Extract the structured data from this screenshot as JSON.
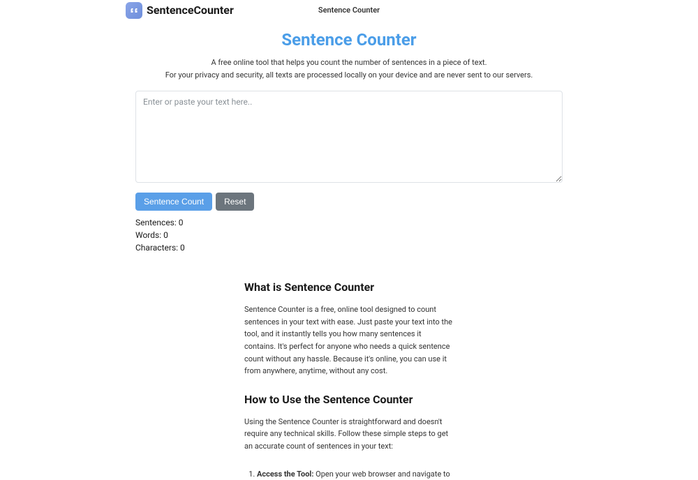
{
  "header": {
    "logo_text": "SentenceCounter",
    "center_link": "Sentence Counter"
  },
  "main": {
    "title": "Sentence Counter",
    "subtitle_line1": "A free online tool that helps you count the number of sentences in a piece of text.",
    "subtitle_line2": "For your privacy and security, all texts are processed locally on your device and are never sent to our servers.",
    "textarea_placeholder": "Enter or paste your text here..",
    "count_button": "Sentence Count",
    "reset_button": "Reset",
    "stats": {
      "sentences_label": "Sentences: ",
      "sentences_value": "0",
      "words_label": "Words: ",
      "words_value": "0",
      "characters_label": "Characters: ",
      "characters_value": "0"
    }
  },
  "article": {
    "heading1": "What is Sentence Counter",
    "para1": "Sentence Counter is a free, online tool designed to count sentences in your text with ease. Just paste your text into the tool, and it instantly tells you how many sentences it contains. It's perfect for anyone who needs a quick sentence count without any hassle. Because it's online, you can use it from anywhere, anytime, without any cost.",
    "heading2": "How to Use the Sentence Counter",
    "para2": "Using the Sentence Counter is straightforward and doesn't require any technical skills. Follow these simple steps to get an accurate count of sentences in your text:",
    "step1_bold": "Access the Tool:",
    "step1_rest": " Open your web browser and navigate to"
  }
}
